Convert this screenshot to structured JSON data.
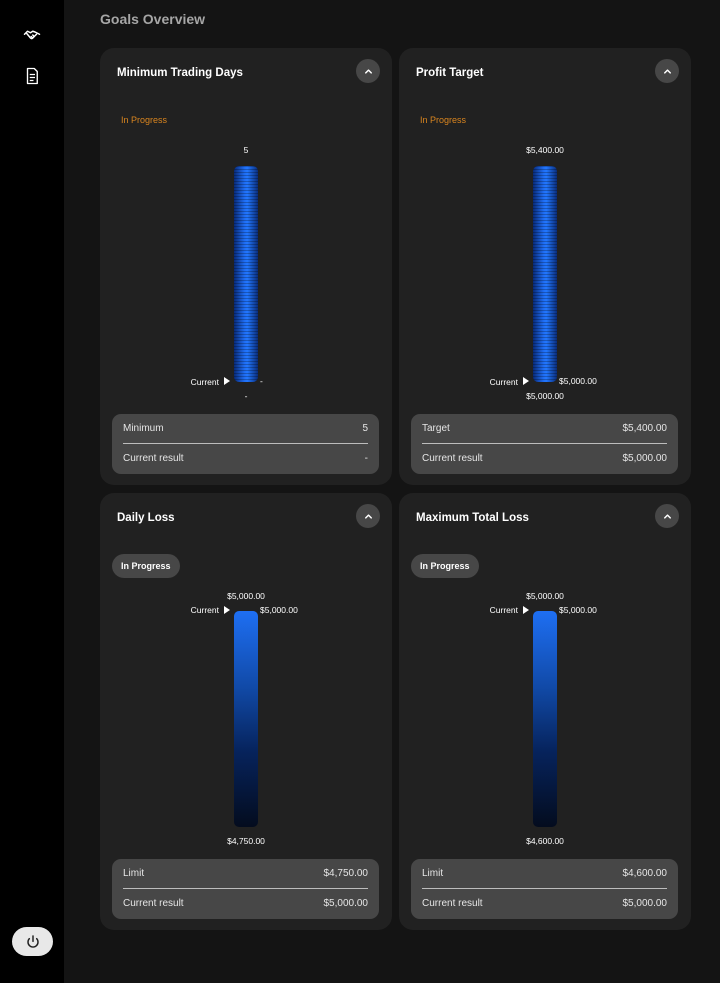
{
  "page": {
    "title": "Goals Overview"
  },
  "sidebar": {
    "items": [
      {
        "icon": "handshake-icon"
      },
      {
        "icon": "document-icon"
      }
    ],
    "power_icon": "power-icon"
  },
  "cards": [
    {
      "title": "Minimum Trading Days",
      "status": "In Progress",
      "bar_top_label": "5",
      "current_label": "Current",
      "current_value": "-",
      "bar_bottom_label": "-",
      "summary": [
        {
          "label": "Minimum",
          "value": "5"
        },
        {
          "label": "Current result",
          "value": "-"
        }
      ]
    },
    {
      "title": "Profit Target",
      "status": "In Progress",
      "bar_top_label": "$5,400.00",
      "current_label": "Current",
      "current_value": "$5,000.00",
      "bar_bottom_label": "$5,000.00",
      "summary": [
        {
          "label": "Target",
          "value": "$5,400.00"
        },
        {
          "label": "Current result",
          "value": "$5,000.00"
        }
      ]
    },
    {
      "title": "Daily Loss",
      "status": "In Progress",
      "bar_top_label": "$5,000.00",
      "current_label": "Current",
      "current_value": "$5,000.00",
      "bar_bottom_label": "$4,750.00",
      "summary": [
        {
          "label": "Limit",
          "value": "$4,750.00"
        },
        {
          "label": "Current result",
          "value": "$5,000.00"
        }
      ]
    },
    {
      "title": "Maximum Total Loss",
      "status": "In Progress",
      "bar_top_label": "$5,000.00",
      "current_label": "Current",
      "current_value": "$5,000.00",
      "bar_bottom_label": "$4,600.00",
      "summary": [
        {
          "label": "Limit",
          "value": "$4,600.00"
        },
        {
          "label": "Current result",
          "value": "$5,000.00"
        }
      ]
    }
  ],
  "colors": {
    "accent_blue": "#1e6ff3",
    "status_orange": "#d9851f",
    "card_bg": "#212121",
    "summary_bg": "#474747"
  }
}
